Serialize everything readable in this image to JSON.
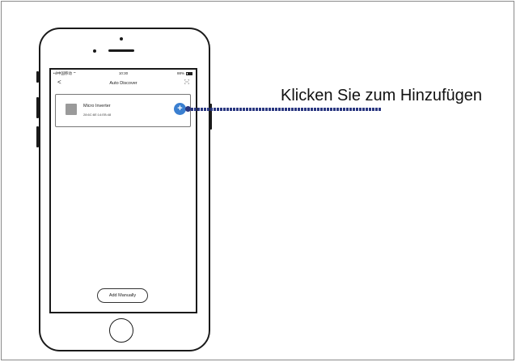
{
  "status_bar": {
    "carrier": "•ıll中国移动 ⌔",
    "time": "10:30",
    "battery_pct": "88%"
  },
  "nav": {
    "back_icon": "chevron-left-icon",
    "title": "Auto Discover",
    "scan_icon": "scan-icon"
  },
  "device": {
    "name": "Micro Inverter",
    "mac": "28:6C:6E:14:EB:48",
    "add_icon": "plus-icon"
  },
  "add_manually_label": "Add Manually",
  "callout": {
    "text": "Klicken Sie zum Hinzufügen",
    "color": "#2a3780"
  },
  "colors": {
    "accent": "#3a7fd0"
  }
}
